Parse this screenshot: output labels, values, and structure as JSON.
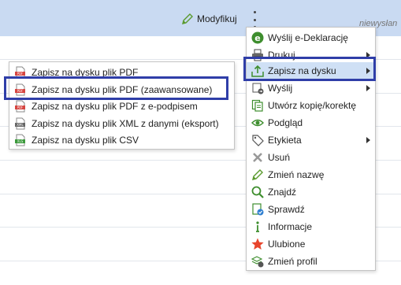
{
  "toolbar": {
    "modify_label": "Modyfikuj",
    "unsent_label": "niewysłan"
  },
  "main_menu": {
    "items": [
      {
        "label": "Wyślij e-Deklarację",
        "icon": "e-declaration-icon",
        "has_submenu": false
      },
      {
        "label": "Drukuj",
        "icon": "printer-icon",
        "has_submenu": true
      },
      {
        "label": "Zapisz na dysku",
        "icon": "save-to-disk-icon",
        "has_submenu": true,
        "active": true
      },
      {
        "label": "Wyślij",
        "icon": "send-icon",
        "has_submenu": true
      },
      {
        "label": "Utwórz kopię/korektę",
        "icon": "copy-document-icon",
        "has_submenu": false
      },
      {
        "label": "Podgląd",
        "icon": "eye-icon",
        "has_submenu": false
      },
      {
        "label": "Etykieta",
        "icon": "tag-icon",
        "has_submenu": true
      },
      {
        "label": "Usuń",
        "icon": "delete-x-icon",
        "has_submenu": false
      },
      {
        "label": "Zmień nazwę",
        "icon": "pencil-icon",
        "has_submenu": false
      },
      {
        "label": "Znajdź",
        "icon": "magnifier-icon",
        "has_submenu": false
      },
      {
        "label": "Sprawdź",
        "icon": "check-document-icon",
        "has_submenu": false
      },
      {
        "label": "Informacje",
        "icon": "info-icon",
        "has_submenu": false
      },
      {
        "label": "Ulubione",
        "icon": "star-icon",
        "has_submenu": false
      },
      {
        "label": "Zmień profil",
        "icon": "profile-layers-icon",
        "has_submenu": false
      }
    ]
  },
  "save_submenu": {
    "items": [
      {
        "label": "Zapisz na dysku plik PDF",
        "icon": "pdf-file-icon",
        "badge": "PDF"
      },
      {
        "label": "Zapisz na dysku plik PDF (zaawansowane)",
        "icon": "pdf-file-icon",
        "badge": "PDF"
      },
      {
        "label": "Zapisz na dysku plik PDF z e-podpisem",
        "icon": "pdf-file-icon",
        "badge": "PDF"
      },
      {
        "label": "Zapisz na dysku plik XML z danymi (eksport)",
        "icon": "xml-file-icon",
        "badge": "XML"
      },
      {
        "label": "Zapisz na dysku plik CSV",
        "icon": "csv-file-icon",
        "badge": "XLS"
      }
    ]
  },
  "colors": {
    "topbar": "#c9daf2",
    "highlight_box": "#2f3ea8",
    "active_item": "#cfe0f5"
  }
}
